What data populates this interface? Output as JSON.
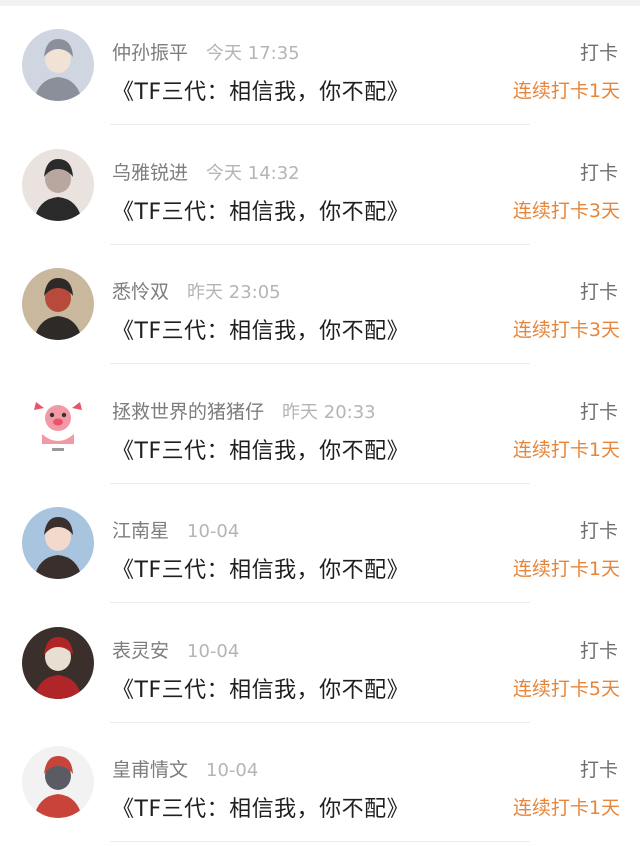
{
  "checkins": [
    {
      "user": "仲孙振平",
      "time": "今天 17:35",
      "content": "《TF三代：相信我，你不配》",
      "action": "打卡",
      "streak": "连续打卡1天",
      "avatar_icon": "user-avatar-icon",
      "avatar_colors": [
        "#cfd6e2",
        "#8a8f99",
        "#f0e2d4"
      ]
    },
    {
      "user": "乌雅锐进",
      "time": "今天 14:32",
      "content": "《TF三代：相信我，你不配》",
      "action": "打卡",
      "streak": "连续打卡3天",
      "avatar_icon": "user-avatar-icon",
      "avatar_colors": [
        "#e9e2df",
        "#2a2a2a",
        "#b8a79f"
      ]
    },
    {
      "user": "悉怜双",
      "time": "昨天 23:05",
      "content": "《TF三代：相信我，你不配》",
      "action": "打卡",
      "streak": "连续打卡3天",
      "avatar_icon": "user-avatar-icon",
      "avatar_colors": [
        "#c9b89d",
        "#2d2a28",
        "#b84a3c"
      ]
    },
    {
      "user": "拯救世界的猪猪仔",
      "time": "昨天 20:33",
      "content": "《TF三代：相信我，你不配》",
      "action": "打卡",
      "streak": "连续打卡1天",
      "avatar_icon": "pig-avatar-icon",
      "avatar_colors": [
        "#ffffff",
        "#f19aa6",
        "#e8556a"
      ]
    },
    {
      "user": "江南星",
      "time": "10-04",
      "content": "《TF三代：相信我，你不配》",
      "action": "打卡",
      "streak": "连续打卡1天",
      "avatar_icon": "user-avatar-icon",
      "avatar_colors": [
        "#a8c4de",
        "#3a2f2c",
        "#f2d9cc"
      ]
    },
    {
      "user": "表灵安",
      "time": "10-04",
      "content": "《TF三代：相信我，你不配》",
      "action": "打卡",
      "streak": "连续打卡5天",
      "avatar_icon": "user-avatar-icon",
      "avatar_colors": [
        "#3b2f2b",
        "#b02528",
        "#e8dfd3"
      ]
    },
    {
      "user": "皇甫情文",
      "time": "10-04",
      "content": "《TF三代：相信我，你不配》",
      "action": "打卡",
      "streak": "连续打卡1天",
      "avatar_icon": "user-avatar-icon",
      "avatar_colors": [
        "#f2f2f2",
        "#c8443b",
        "#5b5b63"
      ]
    }
  ]
}
